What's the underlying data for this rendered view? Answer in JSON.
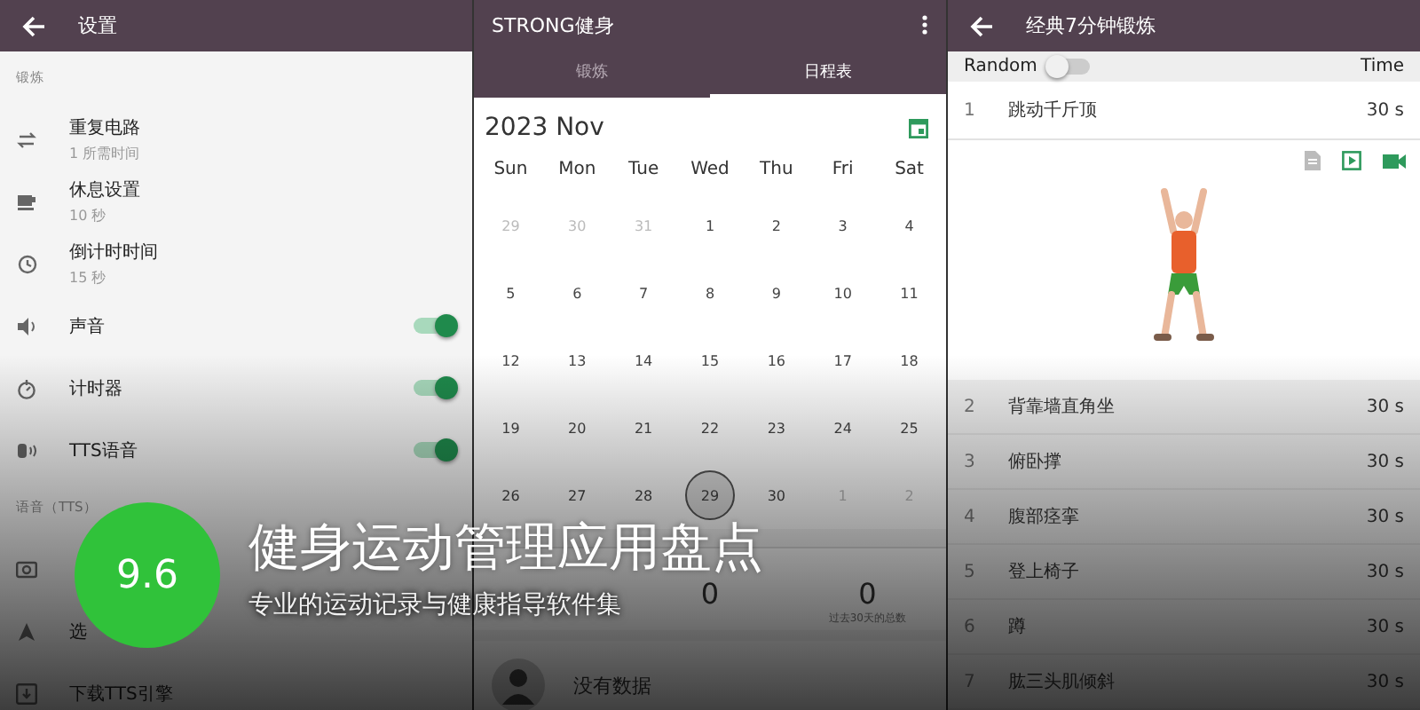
{
  "settings": {
    "title": "设置",
    "sections": [
      {
        "header": "锻炼",
        "items": [
          {
            "label": "重复电路",
            "sub": "1 所需时间",
            "kind": "plain"
          },
          {
            "label": "休息设置",
            "sub": "10 秒",
            "kind": "plain"
          },
          {
            "label": "倒计时时间",
            "sub": "15 秒",
            "kind": "plain"
          },
          {
            "label": "声音",
            "kind": "toggle",
            "on": true
          },
          {
            "label": "计时器",
            "kind": "toggle",
            "on": true
          },
          {
            "label": "TTS语音",
            "kind": "toggle",
            "on": true
          }
        ]
      },
      {
        "header": "语音（TTS）",
        "items": [
          {
            "kind": "plain"
          },
          {
            "label": "选",
            "kind": "plain"
          },
          {
            "label": "下载TTS引擎",
            "kind": "plain"
          }
        ]
      }
    ]
  },
  "calendar": {
    "app_title": "STRONG健身",
    "tabs": [
      {
        "label": "锻炼",
        "selected": false
      },
      {
        "label": "日程表",
        "selected": true
      }
    ],
    "month": "2023 Nov",
    "weekdays": [
      "Sun",
      "Mon",
      "Tue",
      "Wed",
      "Thu",
      "Fri",
      "Sat"
    ],
    "days": [
      {
        "day": "29",
        "muted": true,
        "selected": false
      },
      {
        "day": "30",
        "muted": true,
        "selected": false
      },
      {
        "day": "31",
        "muted": true,
        "selected": false
      },
      {
        "day": "1",
        "muted": false,
        "selected": false
      },
      {
        "day": "2",
        "muted": false,
        "selected": false
      },
      {
        "day": "3",
        "muted": false,
        "selected": false
      },
      {
        "day": "4",
        "muted": false,
        "selected": false
      },
      {
        "day": "5",
        "muted": false,
        "selected": false
      },
      {
        "day": "6",
        "muted": false,
        "selected": false
      },
      {
        "day": "7",
        "muted": false,
        "selected": false
      },
      {
        "day": "8",
        "muted": false,
        "selected": false
      },
      {
        "day": "9",
        "muted": false,
        "selected": false
      },
      {
        "day": "10",
        "muted": false,
        "selected": false
      },
      {
        "day": "11",
        "muted": false,
        "selected": false
      },
      {
        "day": "12",
        "muted": false,
        "selected": false
      },
      {
        "day": "13",
        "muted": false,
        "selected": false
      },
      {
        "day": "14",
        "muted": false,
        "selected": false
      },
      {
        "day": "15",
        "muted": false,
        "selected": false
      },
      {
        "day": "16",
        "muted": false,
        "selected": false
      },
      {
        "day": "17",
        "muted": false,
        "selected": false
      },
      {
        "day": "18",
        "muted": false,
        "selected": false
      },
      {
        "day": "19",
        "muted": false,
        "selected": false
      },
      {
        "day": "20",
        "muted": false,
        "selected": false
      },
      {
        "day": "21",
        "muted": false,
        "selected": false
      },
      {
        "day": "22",
        "muted": false,
        "selected": false
      },
      {
        "day": "23",
        "muted": false,
        "selected": false
      },
      {
        "day": "24",
        "muted": false,
        "selected": false
      },
      {
        "day": "25",
        "muted": false,
        "selected": false
      },
      {
        "day": "26",
        "muted": false,
        "selected": false
      },
      {
        "day": "27",
        "muted": false,
        "selected": false
      },
      {
        "day": "28",
        "muted": false,
        "selected": false
      },
      {
        "day": "29",
        "muted": false,
        "selected": true
      },
      {
        "day": "30",
        "muted": false,
        "selected": false
      },
      {
        "day": "1",
        "muted": true,
        "selected": false
      },
      {
        "day": "2",
        "muted": true,
        "selected": false
      }
    ],
    "stats": [
      {
        "value": "0"
      },
      {
        "value": "0",
        "label": "过去30天的总数"
      }
    ],
    "empty_text": "没有数据"
  },
  "workout": {
    "title": "经典7分钟锻炼",
    "random_label": "Random",
    "random_on": false,
    "time_label": "Time",
    "exercises": [
      {
        "num": "1",
        "name": "跳动千斤顶",
        "time": "30 s",
        "expanded": true
      },
      {
        "num": "2",
        "name": "背靠墙直角坐",
        "time": "30 s",
        "expanded": false
      },
      {
        "num": "3",
        "name": "俯卧撑",
        "time": "30 s",
        "expanded": false
      },
      {
        "num": "4",
        "name": "腹部痉挛",
        "time": "30 s",
        "expanded": false
      },
      {
        "num": "5",
        "name": "登上椅子",
        "time": "30 s",
        "expanded": false
      },
      {
        "num": "6",
        "name": "蹲",
        "time": "30 s",
        "expanded": false
      },
      {
        "num": "7",
        "name": "肱三头肌倾斜",
        "time": "30 s",
        "expanded": false
      }
    ]
  },
  "overlay": {
    "score": "9.6",
    "title": "健身运动管理应用盘点",
    "subtitle": "专业的运动记录与健康指导软件集"
  }
}
